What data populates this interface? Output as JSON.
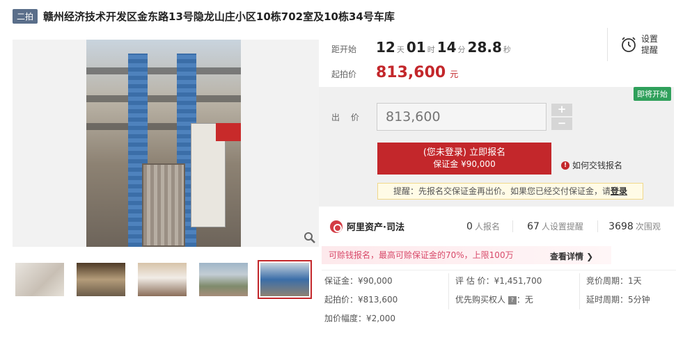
{
  "header": {
    "tag": "二拍",
    "title": "赣州经济技术开发区金东路13号隐龙山庄小区10栋702室及10栋34号车库"
  },
  "countdown": {
    "label": "距开始",
    "days": "12",
    "days_unit": "天",
    "hours": "01",
    "hours_unit": "时",
    "minutes": "14",
    "minutes_unit": "分",
    "seconds": "28.8",
    "seconds_unit": "秒"
  },
  "reminder": {
    "label": "设置提醒"
  },
  "start_price": {
    "label": "起拍价",
    "value": "813,600",
    "unit": "元"
  },
  "bid": {
    "status_badge": "即将开始",
    "label": "出 价",
    "input_placeholder": "813,600",
    "plus": "+",
    "minus": "−",
    "signup_line1": "(您未登录) 立即报名",
    "signup_line2": "保证金 ¥90,000",
    "howto": "如何交钱报名",
    "tip_text": "提醒：先报名交保证金再出价。如果您已经交付保证金，请",
    "tip_link": "登录"
  },
  "platform": {
    "name": "阿里资产·司法"
  },
  "stats": [
    {
      "value": "0",
      "label": "人报名"
    },
    {
      "value": "67",
      "label": "人设置提醒"
    },
    {
      "value": "3698",
      "label": "次围观"
    }
  ],
  "promo": {
    "text": "可赊钱报名，最高可赊保证金的70%，上限100万",
    "link": "查看详情 ❯"
  },
  "details": {
    "deposit": "保证金：¥90,000",
    "start_price": "起拍价：¥813,600",
    "increment": "加价幅度：¥2,000",
    "appraisal": "评 估 价：¥1,451,700",
    "priority": "优先购买权人",
    "priority_value": "：无",
    "cycle": "竞价周期：1天",
    "delay": "延时周期：5分钟"
  },
  "colors": {
    "accent": "#c3272b",
    "badge": "#2fa05b",
    "tag": "#5a6e8a"
  }
}
